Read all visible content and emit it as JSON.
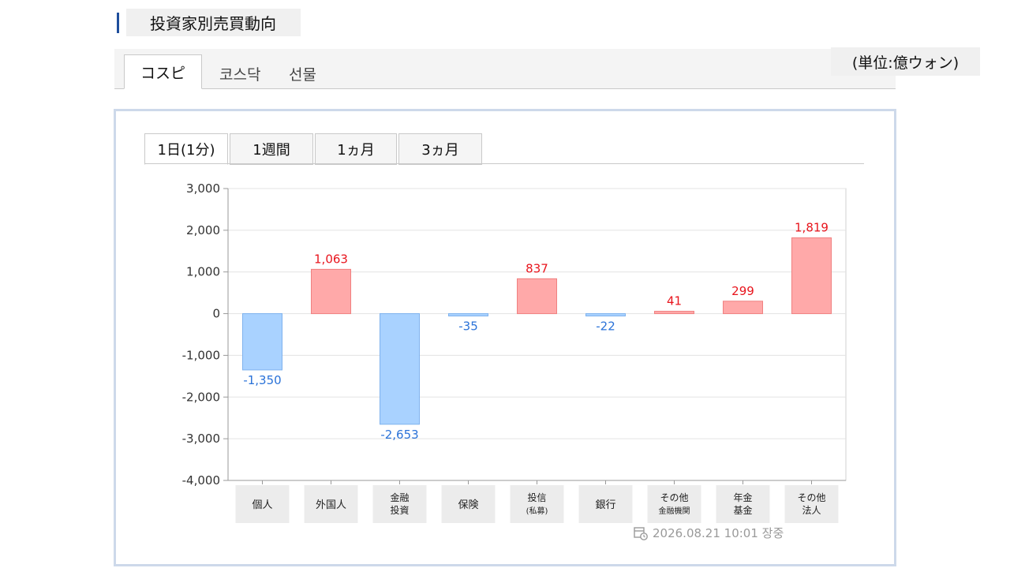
{
  "header": {
    "title": "投資家別売買動向",
    "unit": "(単位:億ウォン)"
  },
  "market_tabs": [
    {
      "label": "コスピ",
      "active": true
    },
    {
      "label": "코스닥",
      "active": false
    },
    {
      "label": "선물",
      "active": false
    }
  ],
  "period_tabs": [
    {
      "label": "1日(1分)",
      "active": true
    },
    {
      "label": "1週間",
      "active": false
    },
    {
      "label": "1ヵ月",
      "active": false
    },
    {
      "label": "3ヵ月",
      "active": false
    }
  ],
  "timestamp": "2026.08.21 10:01 장중",
  "colors": {
    "positive": "#ffa9a9",
    "positive_stroke": "#f08080",
    "positive_text": "#e8141c",
    "negative": "#a9d2ff",
    "negative_stroke": "#7fb2ee",
    "negative_text": "#2a72d8"
  },
  "chart_data": {
    "type": "bar",
    "categories": [
      [
        "個人"
      ],
      [
        "外国人"
      ],
      [
        "金融",
        "投資"
      ],
      [
        "保険"
      ],
      [
        "投信",
        "(私募)"
      ],
      [
        "銀行"
      ],
      [
        "その他",
        "金融機関"
      ],
      [
        "年金",
        "基金"
      ],
      [
        "その他",
        "法人"
      ]
    ],
    "values": [
      -1350,
      1063,
      -2653,
      -35,
      837,
      -22,
      41,
      299,
      1819
    ],
    "data_labels": [
      "-1,350",
      "1,063",
      "-2,653",
      "-35",
      "837",
      "-22",
      "41",
      "299",
      "1,819"
    ],
    "ylim": [
      -4000,
      3000
    ],
    "yticks": [
      3000,
      2000,
      1000,
      0,
      -1000,
      -2000,
      -3000,
      -4000
    ],
    "ytick_labels": [
      "3,000",
      "2,000",
      "1,000",
      "0",
      "-1,000",
      "-2,000",
      "-3,000",
      "-4,000"
    ],
    "grid": true,
    "title": "",
    "xlabel": "",
    "ylabel": ""
  }
}
